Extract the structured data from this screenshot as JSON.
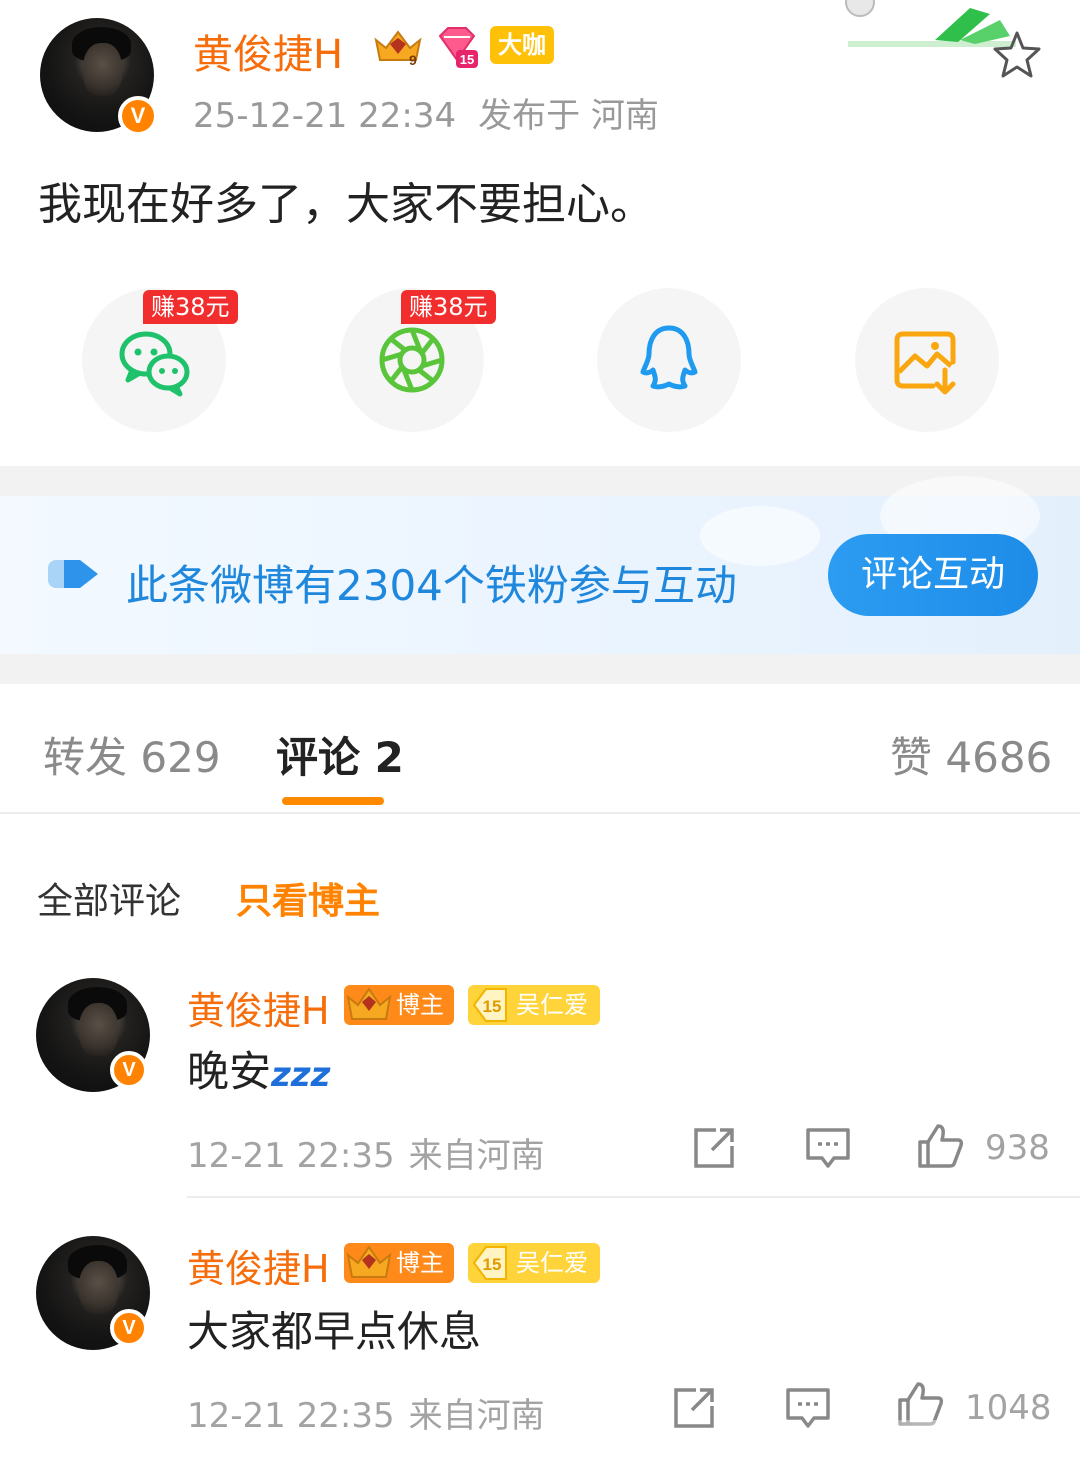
{
  "post": {
    "author": "黄俊捷H",
    "crown_level": "9",
    "member_level": "15",
    "daka_label": "大咖",
    "time": "25-12-21 22:34",
    "location": "发布于 河南",
    "text": "我现在好多了，大家不要担心。"
  },
  "share": {
    "reward_wechat": "赚38元",
    "reward_moments": "赚38元",
    "items": [
      {
        "name": "wechat",
        "icon": "wechat-icon",
        "color": "#1fc26b"
      },
      {
        "name": "moments",
        "icon": "moments-icon",
        "color": "#5ac53b"
      },
      {
        "name": "qq",
        "icon": "qq-icon",
        "color": "#1e9bf0"
      },
      {
        "name": "save-image",
        "icon": "save-image-icon",
        "color": "#f9a60f"
      }
    ]
  },
  "fan_banner": {
    "text": "此条微博有2304个铁粉参与互动",
    "button": "评论互动"
  },
  "tabs": {
    "repost_label": "转发",
    "repost_count": "629",
    "comment_label": "评论",
    "comment_count": "2",
    "like_label": "赞",
    "like_count": "4686"
  },
  "filters": {
    "all": "全部评论",
    "owner_only": "只看博主"
  },
  "comments": [
    {
      "author": "黄俊捷H",
      "owner_tag": "博主",
      "fan_level": "15",
      "fan_tag": "吴仁爱",
      "text": "晚安",
      "emoji": "zzz",
      "time": "12-21 22:35",
      "location": "来自河南",
      "likes": "938"
    },
    {
      "author": "黄俊捷H",
      "owner_tag": "博主",
      "fan_level": "15",
      "fan_tag": "吴仁爱",
      "text": "大家都早点休息",
      "time": "12-21 22:35",
      "location": "来自河南",
      "likes": "1048"
    }
  ],
  "colors": {
    "accent": "#ff8200",
    "username": "#f66e0c",
    "link_blue": "#1f88dc",
    "reward_red": "#f22d2d"
  }
}
